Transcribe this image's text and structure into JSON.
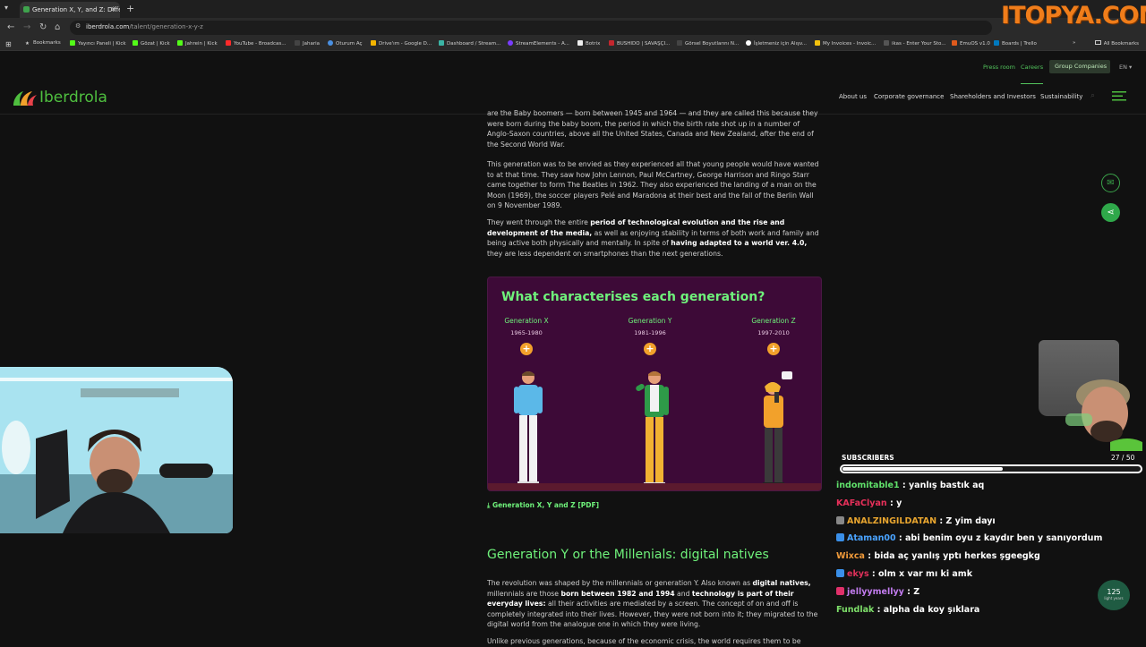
{
  "browser": {
    "tab_title": "Generation X, Y, and Z: Differe",
    "url_domain": "iberdrola.com",
    "url_path": "/talent/generation-x-y-z",
    "bookmarks": [
      "Bookmarks",
      "Yayıncı Paneli | Kick",
      "Gözat | Kick",
      "Jahrein | Kick",
      "YouTube - Broadcas...",
      "Jaharia",
      "Oturum Aç",
      "Drive'ım - Google D...",
      "Dashboard / Stream...",
      "StreamElements - A...",
      "Botrix",
      "BUSHIDO | SAVAŞÇI...",
      "Görsel Boyutlarını N...",
      "İşletmeniz için Alışv...",
      "My Invoices - Invoic...",
      "ikas - Enter Your Sto...",
      "EmuOS v1.0",
      "Boards | Trello"
    ],
    "all_bookmarks": "All Bookmarks"
  },
  "overlay_logo": "ITOPYA.COM",
  "site": {
    "logo_text": "Iberdrola",
    "top_links": [
      "Press room",
      "Careers"
    ],
    "group_companies": "Group Companies",
    "lang": "EN",
    "nav": [
      "About us",
      "Corporate governance",
      "Shareholders and Investors",
      "Sustainability"
    ]
  },
  "article": {
    "p0": "are the Baby boomers — born between 1945 and 1964 — and they are called this because they were born during the baby boom, the period in which the birth rate shot up in a number of Anglo-Saxon countries, above all the United States, Canada and New Zealand, after the end of the Second World War.",
    "p1": "This generation was to be envied as they experienced all that young people would have wanted to at that time. They saw how John Lennon, Paul McCartney, George Harrison and Ringo Starr came together to form The Beatles in 1962. They also experienced the landing of a man on the Moon (1969), the soccer players Pelé and Maradona at their best and the fall of the Berlin Wall on 9 November 1989.",
    "p2_a": "They went through the entire ",
    "p2_b": "period of technological evolution and the rise and development of the media,",
    "p2_c": " as well as enjoying stability in terms of both work and family and being active both physically and mentally. In spite of ",
    "p2_d": "having adapted to a world ver. 4.0,",
    "p2_e": " they are less dependent on smartphones than the next generations.",
    "card_title": "What characterises each generation?",
    "generations": [
      {
        "name": "Generation X",
        "years": "1965-1980"
      },
      {
        "name": "Generation Y",
        "years": "1981-1996"
      },
      {
        "name": "Generation Z",
        "years": "1997-2010"
      }
    ],
    "pdf_link": "Generation X, Y and Z [PDF]",
    "h2": "Generation Y or the Millenials: digital natives",
    "p3_a": "The revolution was shaped by the millennials or generation Y. Also known as ",
    "p3_b": "digital natives,",
    "p3_c": " millennials are those ",
    "p3_d": "born between 1982 and 1994",
    "p3_e": " and ",
    "p3_f": "technology is part of their everyday lives:",
    "p3_g": " all their activities are mediated by a screen. The concept of on and off is completely integrated into their lives. However, they were not born into it; they migrated to the digital world from the analogue one in which they were living.",
    "p4": "Unlike previous generations, because of the economic crisis, the world requires them to be"
  },
  "badge": {
    "number": "125",
    "sub": "light years"
  },
  "stream": {
    "subscribers_label": "SUBSCRIBERS",
    "subscribers_count": "27 / 50",
    "subscribers_progress": 0.54,
    "chat": [
      {
        "user": "indomitable1",
        "text": " : yanlış bastık aq",
        "color": "#5fe06a",
        "badge": ""
      },
      {
        "user": "KAFaClyan",
        "text": " : y",
        "color": "#e8305a",
        "badge": ""
      },
      {
        "user": "ANALZINGILDATAN",
        "text": " : Z yim dayı",
        "color": "#e8a52f",
        "badge": "#888888"
      },
      {
        "user": "Ataman00",
        "text": " : abi benim oyu z kaydır ben y sanıyordum",
        "color": "#4aa3ff",
        "badge": "#3a8fe8"
      },
      {
        "user": "Wixca",
        "text": " : bida aç yanlış yptı herkes şgeegkg",
        "color": "#f09a3a",
        "badge": ""
      },
      {
        "user": "ekys",
        "text": " : olm x var mı ki amk",
        "color": "#e0305a",
        "badge": "#3a8fe8"
      },
      {
        "user": "jellyymellyy",
        "text": " : Z",
        "color": "#c37cf0",
        "badge": "#e0306a"
      },
      {
        "user": "Fundlak",
        "text": " : alpha da koy şıklara",
        "color": "#7ee06a",
        "badge": ""
      }
    ]
  }
}
